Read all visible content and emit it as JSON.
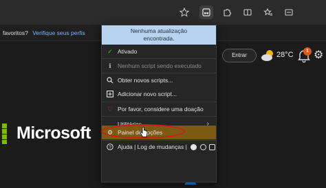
{
  "toolbar": {
    "icons": [
      "star-outline-icon",
      "extension-active-icon",
      "extensions-puzzle-icon",
      "split-screen-icon",
      "favorites-icon",
      "copilot-icon"
    ]
  },
  "infobar": {
    "question": "favoritos?",
    "link": "Verifique seus perfis"
  },
  "popup": {
    "header_line1": "Nenhuma atualização",
    "header_line2": "encontrada.",
    "items": [
      {
        "label": "Ativado",
        "icon": "check-icon"
      },
      {
        "label": "Nenhum script sendo executado",
        "icon": "info-icon"
      },
      {
        "label": "Obter novos scripts...",
        "icon": "search-icon"
      },
      {
        "label": "Adicionar novo script...",
        "icon": "plus-square-icon"
      },
      {
        "label": "Por favor, considere uma doação",
        "icon": "heart-icon"
      },
      {
        "label": "Utilitários",
        "icon": ""
      },
      {
        "label": "Painel de opções",
        "icon": "gear-icon"
      },
      {
        "label": "Ajuda | Log de mudanças |",
        "icon": "help-icon"
      }
    ]
  },
  "page": {
    "signin_label": "Entrar",
    "temperature": "28°C",
    "notification_count": "1",
    "brand": "Microsoft"
  },
  "colors": {
    "highlight": "#7c5a12",
    "header_bg": "#b7d3ef",
    "annotation_red": "#d21919",
    "check_green": "#4fb34f",
    "heart_red": "#e05050"
  }
}
